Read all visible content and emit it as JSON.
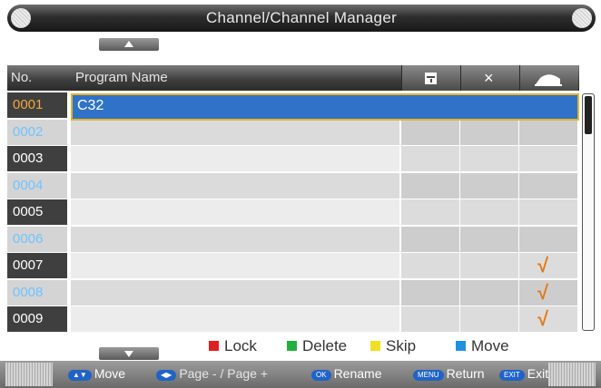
{
  "title": "Channel/Channel Manager",
  "header": {
    "no": "No.",
    "program_name": "Program Name",
    "lock_icon": "lock-icon",
    "delete_icon": "delete-icon",
    "delete_glyph": "×",
    "skip_icon": "skip-icon"
  },
  "rows": [
    {
      "no": "0001",
      "name": "C32",
      "lock": false,
      "delete": false,
      "skip": false
    },
    {
      "no": "0002",
      "name": "",
      "lock": false,
      "delete": false,
      "skip": false
    },
    {
      "no": "0003",
      "name": "",
      "lock": false,
      "delete": false,
      "skip": false
    },
    {
      "no": "0004",
      "name": "",
      "lock": false,
      "delete": false,
      "skip": false
    },
    {
      "no": "0005",
      "name": "",
      "lock": false,
      "delete": false,
      "skip": false
    },
    {
      "no": "0006",
      "name": "",
      "lock": false,
      "delete": false,
      "skip": false
    },
    {
      "no": "0007",
      "name": "",
      "lock": false,
      "delete": false,
      "skip": true
    },
    {
      "no": "0008",
      "name": "",
      "lock": false,
      "delete": false,
      "skip": true
    },
    {
      "no": "0009",
      "name": "",
      "lock": false,
      "delete": false,
      "skip": true
    }
  ],
  "check_glyph": "√",
  "legend": [
    {
      "label": "Lock",
      "color": "#e02020"
    },
    {
      "label": "Delete",
      "color": "#20b040"
    },
    {
      "label": "Skip",
      "color": "#f0e020"
    },
    {
      "label": "Move",
      "color": "#2090e0"
    }
  ],
  "footer": {
    "move": "Move",
    "page": "Page - / Page +",
    "ok_key": "OK",
    "rename": "Rename",
    "menu_key": "MENU",
    "return": "Return",
    "exit_key": "EXIT",
    "exit": "Exit"
  },
  "colors": {
    "selected_row": "#2f72c8",
    "selected_border": "#e5b42a",
    "check": "#e07a1a",
    "highlight_no": "#f1a83a",
    "light_no": "#6fc4ff"
  }
}
